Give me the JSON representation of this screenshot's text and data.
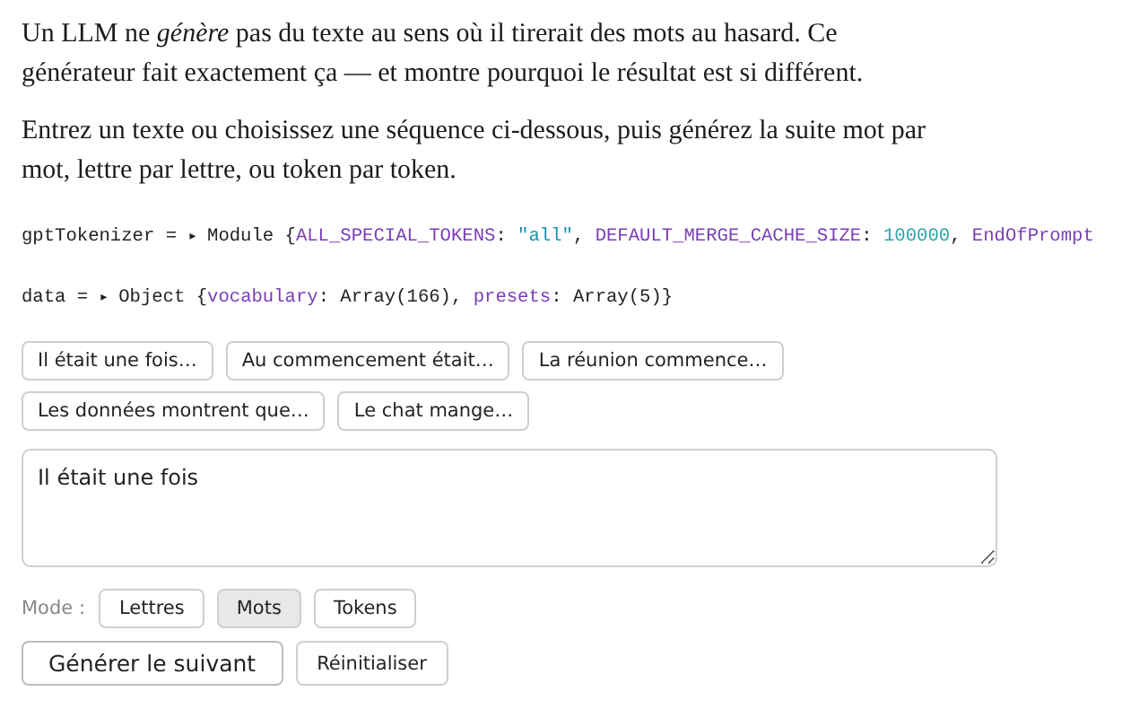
{
  "intro": [
    "Un LLM ne *génère* pas du texte au sens où il tirerait des mots au hasard. Ce générateur fait exactement ça — et montre pourquoi le résultat est si différent.",
    "Entrez un texte ou choisissez une séquence ci-dessous, puis générez la suite mot par mot, lettre par lettre, ou token par token."
  ],
  "cells": [
    {
      "tokens": [
        {
          "text": "gptTokenizer = ",
          "kind": "plain"
        },
        {
          "text": "▸ ",
          "kind": "caret"
        },
        {
          "text": "Module {",
          "kind": "plain"
        },
        {
          "text": "ALL_SPECIAL_TOKENS",
          "kind": "key"
        },
        {
          "text": ": ",
          "kind": "plain"
        },
        {
          "text": "\"all\"",
          "kind": "string"
        },
        {
          "text": ", ",
          "kind": "plain"
        },
        {
          "text": "DEFAULT_MERGE_CACHE_SIZE",
          "kind": "key"
        },
        {
          "text": ": ",
          "kind": "plain"
        },
        {
          "text": "100000",
          "kind": "number"
        },
        {
          "text": ", ",
          "kind": "plain"
        },
        {
          "text": "EndOfPrompt",
          "kind": "key"
        }
      ]
    },
    {
      "tokens": [
        {
          "text": "data = ",
          "kind": "plain"
        },
        {
          "text": "▸ ",
          "kind": "caret"
        },
        {
          "text": "Object {",
          "kind": "plain"
        },
        {
          "text": "vocabulary",
          "kind": "key"
        },
        {
          "text": ": Array(166), ",
          "kind": "plain"
        },
        {
          "text": "presets",
          "kind": "key"
        },
        {
          "text": ": Array(5)}",
          "kind": "plain"
        }
      ]
    }
  ],
  "presets": [
    [
      "Il était une fois…",
      "Au commencement était…",
      "La réunion commence…"
    ],
    [
      "Les données montrent que…",
      "Le chat mange…"
    ]
  ],
  "input": {
    "value": "Il était une fois"
  },
  "mode": {
    "label": "Mode :",
    "options": [
      {
        "label": "Lettres",
        "selected": false
      },
      {
        "label": "Mots",
        "selected": true
      },
      {
        "label": "Tokens",
        "selected": false
      }
    ]
  },
  "actions": [
    {
      "label": "Générer le suivant",
      "kind": "primary"
    },
    {
      "label": "Réinitialiser",
      "kind": "secondary"
    }
  ]
}
